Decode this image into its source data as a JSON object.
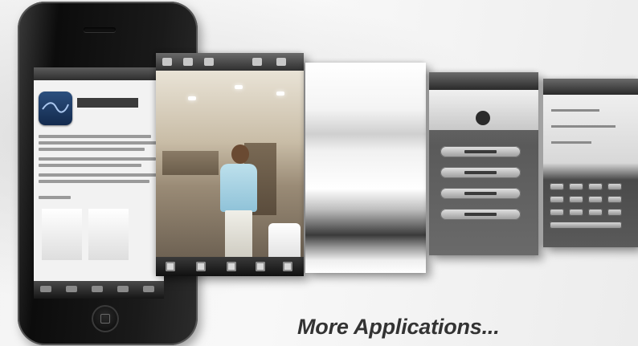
{
  "caption": "More Applications...",
  "colors": {
    "caption_text": "#333333",
    "phone_body": "#141414",
    "app_icon": "#1d3a66",
    "background": "#f4f4f4"
  },
  "icons": [
    "home-button",
    "app-logo-wave-icon"
  ]
}
